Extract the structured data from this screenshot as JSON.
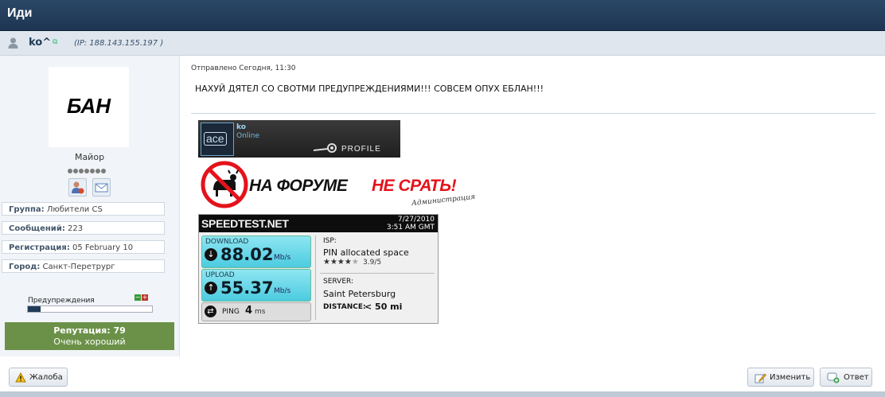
{
  "header": {
    "title": "Иди"
  },
  "user": {
    "name": "ko^",
    "ip": "(IP: 188.143.155.197 )"
  },
  "profile": {
    "avatar_text": "БАН",
    "rank": "Майор",
    "pips": 7,
    "fields": [
      {
        "label": "Группа:",
        "value": "Любители CS"
      },
      {
        "label": "Сообщений:",
        "value": "223"
      },
      {
        "label": "Регистрация:",
        "value": "05 February 10"
      },
      {
        "label": "Город:",
        "value": "Санкт-Перетрург"
      }
    ],
    "warnings_label": "Предупреждения",
    "warnings_level": 0.1,
    "reputation_title": "Репутация: 79",
    "reputation_desc": "Очень хороший"
  },
  "post": {
    "posted": "Отправлено Сегодня, 11:30",
    "message": "НАХУЙ ДЯТЕЛ СО СВОТМИ ПРЕДУПРЕЖДЕНИЯМИ!!! СОВСЕМ ОПУХ ЕБЛАН!!!"
  },
  "steam": {
    "logo": "ace",
    "name": "ko",
    "status": "Online",
    "profile": "PROFILE"
  },
  "banner": {
    "part1": "НА ФОРУМЕ ",
    "part2": "НЕ СРАТЬ!",
    "sign": "Администрация"
  },
  "speedtest": {
    "brand": "SPEEDTEST.NET",
    "date": "7/27/2010",
    "time": "3:51 AM GMT",
    "download_label": "DOWNLOAD",
    "download_value": "88.02",
    "upload_label": "UPLOAD",
    "upload_value": "55.37",
    "unit": "Mb/s",
    "ping_label": "PING",
    "ping_value": "4",
    "ping_unit": "ms",
    "isp_label": "ISP:",
    "isp_value": "PIN allocated space",
    "rating_stars": "★★★★",
    "rating_empty": "★",
    "rating": "3.9/5",
    "server_label": "SERVER:",
    "server_value": "Saint Petersburg",
    "distance_label": "DISTANCE:",
    "distance_value": "< 50 mi"
  },
  "footer": {
    "complaint": "Жалоба",
    "edit": "Изменить",
    "reply": "Ответ"
  },
  "colors": {
    "header": "#1d3552",
    "reputation": "#6b9148",
    "speed_cyan": "#58d4e6",
    "banner_red": "#e5121b"
  }
}
